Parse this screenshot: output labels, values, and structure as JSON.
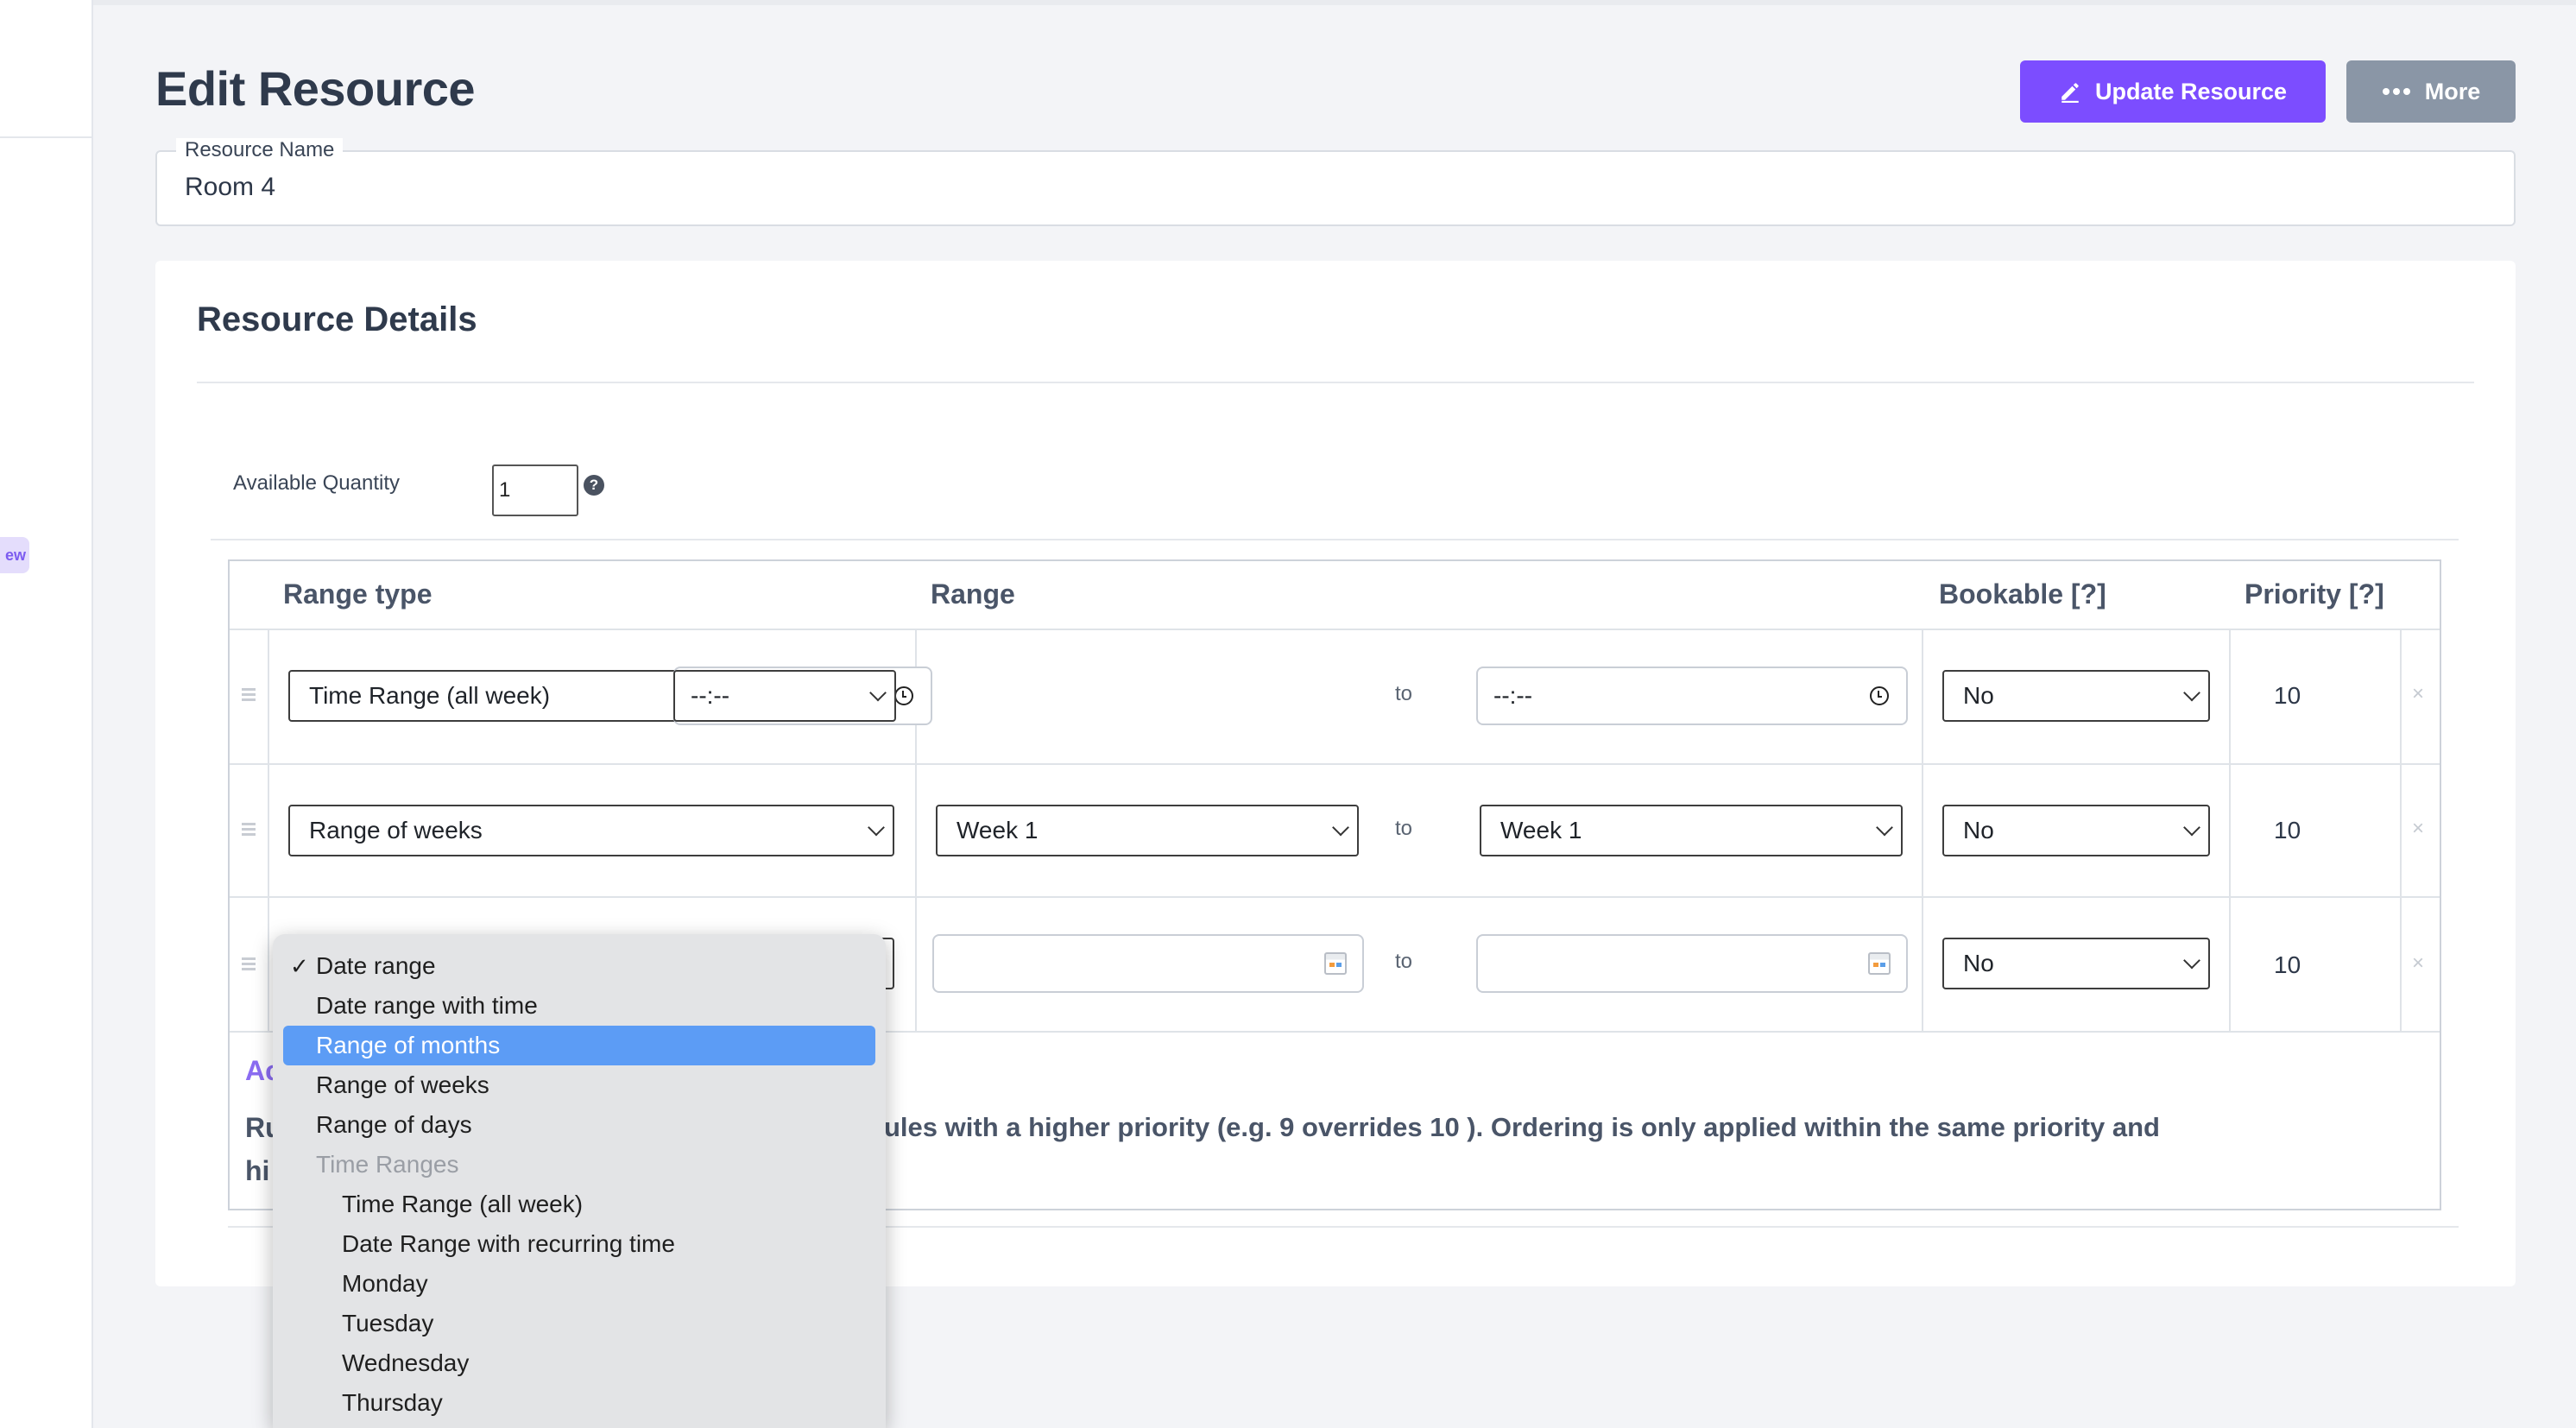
{
  "sidebar": {
    "badge": "ew"
  },
  "header": {
    "title": "Edit Resource",
    "update_label": "Update Resource",
    "more_label": "More"
  },
  "resource": {
    "name_label": "Resource Name",
    "name_value": "Room 4"
  },
  "details": {
    "title": "Resource Details",
    "quantity_label": "Available Quantity",
    "quantity_value": "1",
    "help_symbol": "?"
  },
  "table": {
    "headers": {
      "range_type": "Range type",
      "range": "Range",
      "bookable": "Bookable [?]",
      "priority": "Priority [?]"
    },
    "to_label": "to",
    "remove_symbol": "×",
    "rows": [
      {
        "range_type": "Time Range (all week)",
        "from": "--:--",
        "to": "--:--",
        "bookable": "No",
        "priority": "10"
      },
      {
        "range_type": "Range of weeks",
        "from": "Week 1",
        "to": "Week 1",
        "bookable": "No",
        "priority": "10"
      },
      {
        "range_type": "Date range",
        "from": "",
        "to": "",
        "bookable": "No",
        "priority": "10"
      }
    ]
  },
  "advanced": {
    "title": "Ac",
    "rules_line1_start": "Ru",
    "rules_line2_start": "hi",
    "rules_text": "ules with a higher priority (e.g. 9 overrides 10 ). Ordering is only applied within the same priority and"
  },
  "dropdown": {
    "check_symbol": "✓",
    "options": [
      {
        "label": "Date range",
        "selected": true
      },
      {
        "label": "Date range with time"
      },
      {
        "label": "Range of months",
        "highlighted": true
      },
      {
        "label": "Range of weeks"
      },
      {
        "label": "Range of days"
      },
      {
        "label": "Time Ranges",
        "group": true
      },
      {
        "label": "Time Range (all week)",
        "indent": true
      },
      {
        "label": "Date Range with recurring time",
        "indent": true
      },
      {
        "label": "Monday",
        "indent": true
      },
      {
        "label": "Tuesday",
        "indent": true
      },
      {
        "label": "Wednesday",
        "indent": true
      },
      {
        "label": "Thursday",
        "indent": true
      }
    ]
  },
  "colors": {
    "accent": "#7c4dff",
    "more_button": "#8a96a6",
    "highlight": "#5c9cf5",
    "advanced_title": "#8b6cf2"
  }
}
